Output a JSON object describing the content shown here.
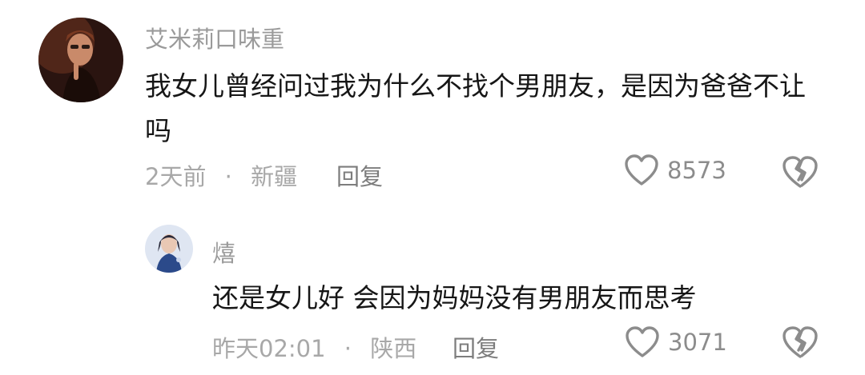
{
  "comments": [
    {
      "username": "艾米莉口味重",
      "text": "我女儿曾经问过我为什么不找个男朋友，是因为爸爸不让吗",
      "time": "2天前",
      "separator": "·",
      "location": "新疆",
      "reply_label": "回复",
      "like_count": "8573",
      "avatar_icon": "user-avatar-photo",
      "like_icon": "heart-outline-icon",
      "dislike_icon": "broken-heart-icon"
    },
    {
      "username": "熺",
      "text": "还是女儿好 会因为妈妈没有男朋友而思考",
      "time": "昨天02:01",
      "separator": "·",
      "location": "陕西",
      "reply_label": "回复",
      "like_count": "3071",
      "avatar_icon": "user-avatar-photo",
      "like_icon": "heart-outline-icon",
      "dislike_icon": "broken-heart-icon"
    }
  ],
  "colors": {
    "username": "#9a9a9a",
    "text": "#161616",
    "meta": "#a8a8a8",
    "reply": "#7d7d7d",
    "icon": "#8c8c8c"
  }
}
